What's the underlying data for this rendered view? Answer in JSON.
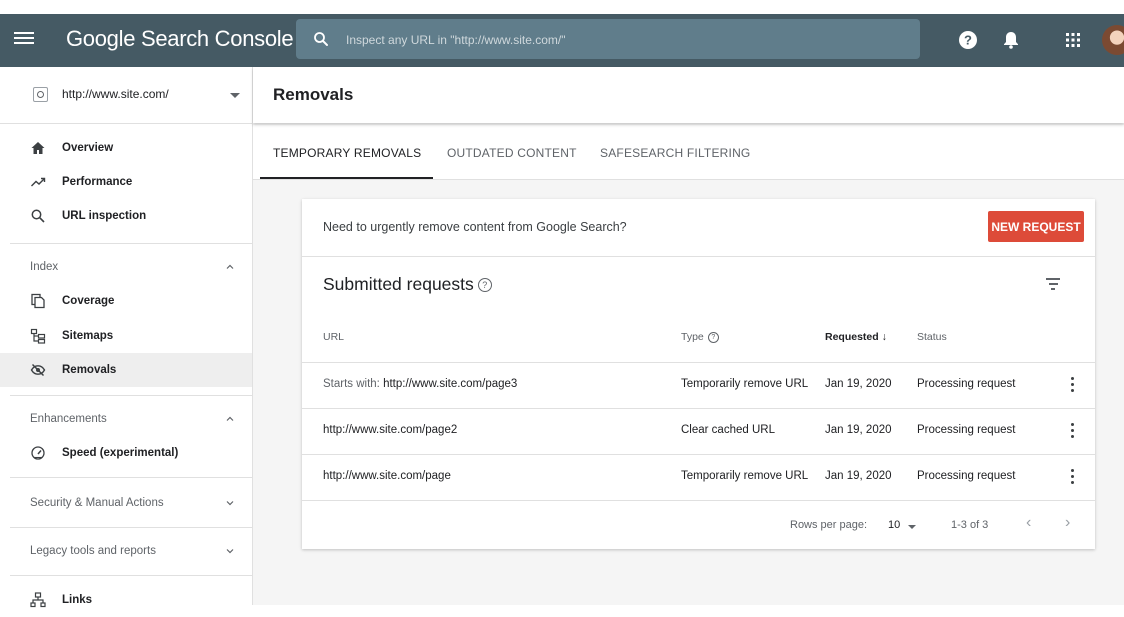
{
  "app": {
    "brand": "Google Search Console"
  },
  "search": {
    "placeholder": "Inspect any URL in \"http://www.site.com/\""
  },
  "sidebar": {
    "property": "http://www.site.com/",
    "top_items": [
      "Overview",
      "Performance",
      "URL inspection"
    ],
    "index_section": "Index",
    "index_items": [
      "Coverage",
      "Sitemaps",
      "Removals"
    ],
    "enhancements_section": "Enhancements",
    "enhancement_items": [
      "Speed (experimental)"
    ],
    "security_section": "Security & Manual Actions",
    "legacy_section": "Legacy tools and reports",
    "links_item": "Links"
  },
  "page": {
    "title": "Removals"
  },
  "tabs": [
    "TEMPORARY REMOVALS",
    "OUTDATED CONTENT",
    "SAFESEARCH FILTERING"
  ],
  "card": {
    "notice": "Need to urgently remove content from Google Search?",
    "new_request": "NEW REQUEST",
    "subtitle": "Submitted requests",
    "help_glyph": "?"
  },
  "table": {
    "headers": {
      "url": "URL",
      "type": "Type",
      "requested": "Requested",
      "status": "Status"
    },
    "rows": [
      {
        "prefix": "Starts with: ",
        "url": "http://www.site.com/page3",
        "type": "Temporarily remove URL",
        "requested": "Jan 19, 2020",
        "status": "Processing request"
      },
      {
        "prefix": "",
        "url": "http://www.site.com/page2",
        "type": "Clear cached URL",
        "requested": "Jan 19, 2020",
        "status": "Processing request"
      },
      {
        "prefix": "",
        "url": "http://www.site.com/page",
        "type": "Temporarily remove URL",
        "requested": "Jan 19, 2020",
        "status": "Processing request"
      }
    ],
    "sort_indicator": "↓"
  },
  "pagination": {
    "rows_label": "Rows per page:",
    "rows_value": "10",
    "range": "1-3 of 3",
    "prev": "‹",
    "next": "›"
  },
  "colors": {
    "topbar": "#455a64",
    "accent": "#dd4b39"
  }
}
